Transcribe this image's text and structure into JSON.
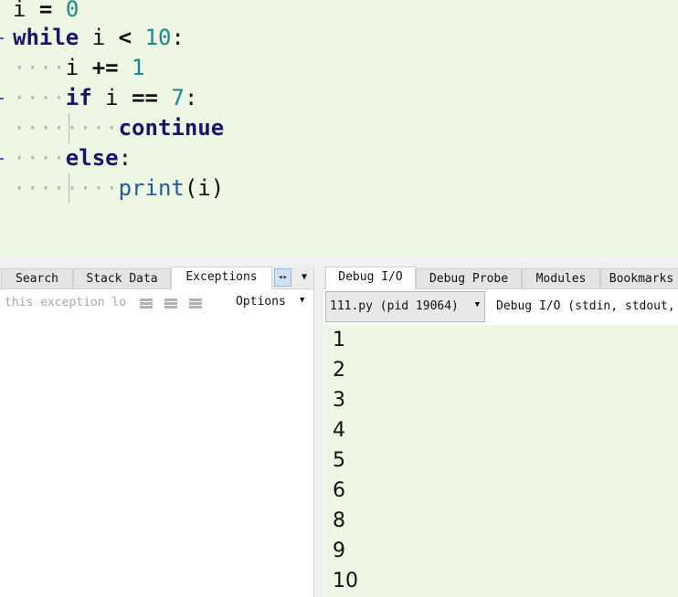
{
  "editor": {
    "lines": [
      {
        "a": "i",
        "b": " = ",
        "c": "0"
      },
      {
        "kw": "while",
        "a": " i ",
        "op": "<",
        "num": " 10",
        "tail": ":"
      },
      {
        "a": "i",
        "op": " +=",
        "num": " 1"
      },
      {
        "kw": "if",
        "a": " i ",
        "op": "==",
        "num": " 7",
        "tail": ":"
      },
      {
        "kw": "continue"
      },
      {
        "kw": "else",
        "tail": ":"
      },
      {
        "fn": "print",
        "tail": "(i)"
      }
    ]
  },
  "left_panel": {
    "tabs": [
      "Search",
      "Stack Data",
      "Exceptions"
    ],
    "active_tab": "Exceptions",
    "exception_message": "this exception lo",
    "options_label": "Options"
  },
  "right_panel": {
    "tabs": [
      "Debug I/O",
      "Debug Probe",
      "Modules",
      "Bookmarks"
    ],
    "active_tab": "Debug I/O",
    "process_select": "111.py (pid 19064)",
    "io_description": "Debug I/O (stdin, stdout,",
    "output_lines": [
      "1",
      "2",
      "3",
      "4",
      "5",
      "6",
      "8",
      "9",
      "10"
    ]
  },
  "colors": {
    "editor_bg": "#eef7e4",
    "keyword": "#16166e",
    "number": "#1a8a8a",
    "builtin": "#1f5a9a",
    "margin_marker": "#4a5bd8"
  },
  "icons": [
    "tab-scroll-arrows-icon",
    "tab-menu-caret-icon",
    "filter-icon",
    "dropdown-caret-icon"
  ]
}
